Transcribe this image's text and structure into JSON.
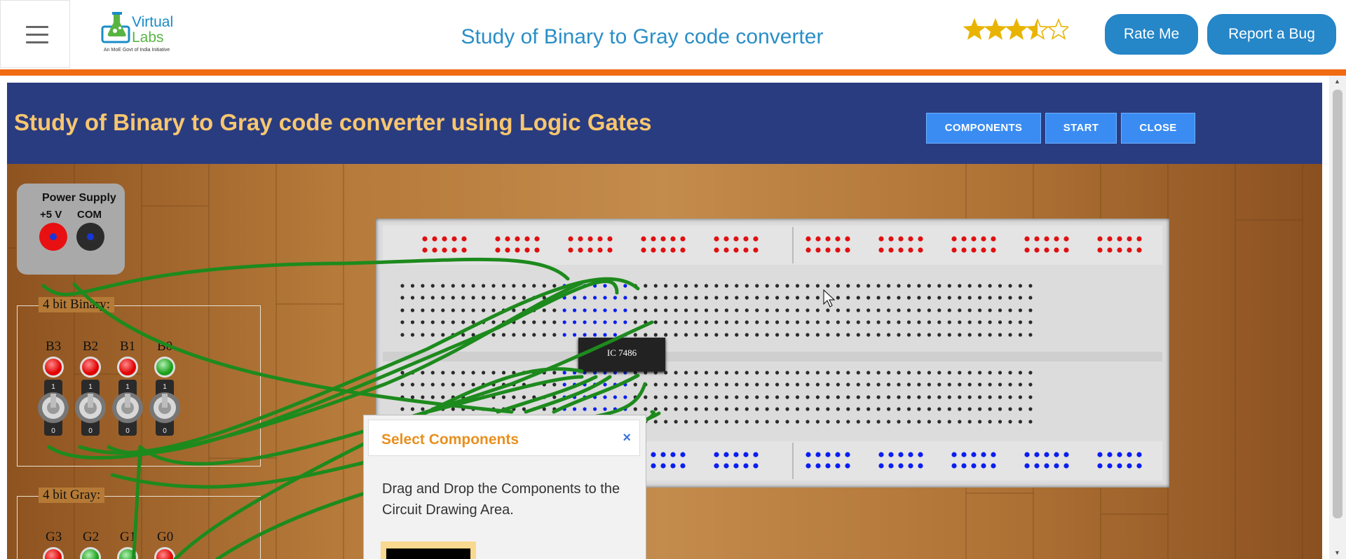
{
  "header": {
    "title": "Study of Binary to Gray code converter",
    "logo": {
      "name": "Virtual",
      "name2": "Labs",
      "tagline": "An MoE Govt of India Initiative"
    },
    "rating": {
      "value": 3.5,
      "max": 5
    },
    "rate_label": "Rate Me",
    "bug_label": "Report a Bug"
  },
  "simulator": {
    "title": "Study of Binary to Gray code converter using Logic Gates",
    "buttons": {
      "components": "COMPONENTS",
      "start": "START",
      "close": "CLOSE"
    },
    "power_supply": {
      "label": "Power Supply",
      "plus": "+5 V",
      "com": "COM"
    },
    "binary_group": {
      "label": "4 bit Binary:",
      "switches": [
        {
          "name": "B3",
          "led": "red",
          "on": "1",
          "off": "0"
        },
        {
          "name": "B2",
          "led": "red",
          "on": "1",
          "off": "0"
        },
        {
          "name": "B1",
          "led": "red",
          "on": "1",
          "off": "0"
        },
        {
          "name": "B0",
          "led": "green",
          "on": "1",
          "off": "0"
        }
      ]
    },
    "gray_group": {
      "label": "4 bit Gray:",
      "outputs": [
        {
          "name": "G3",
          "led": "red"
        },
        {
          "name": "G2",
          "led": "green"
        },
        {
          "name": "G1",
          "led": "green"
        },
        {
          "name": "G0",
          "led": "red"
        }
      ]
    },
    "breadboard": {
      "ic_label": "IC 7486"
    }
  },
  "dialog": {
    "title": "Select Components",
    "close": "×",
    "body": "Drag and Drop the Components to the Circuit Drawing Area."
  },
  "colors": {
    "accent": "#2586c8",
    "orange_bar": "#f06b12",
    "sim_header": "#2a3c80",
    "sim_title": "#f8c66f",
    "wire": "#1d8a1d",
    "hole_red": "#e01010",
    "hole_blue": "#0b1ef0"
  }
}
